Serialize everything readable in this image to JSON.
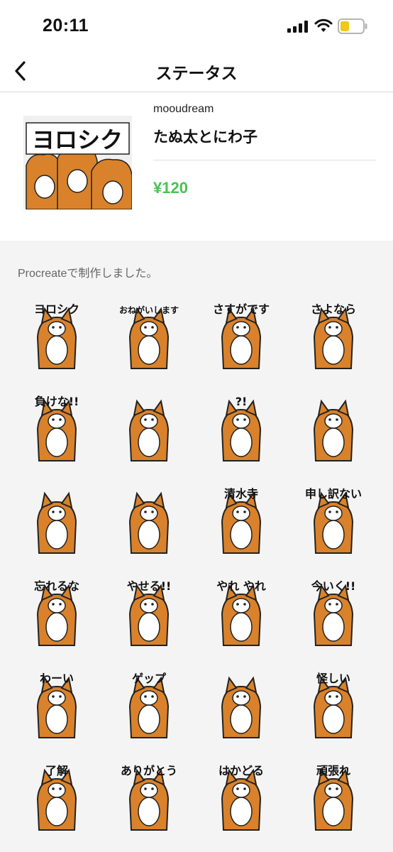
{
  "status_bar": {
    "time": "20:11"
  },
  "nav": {
    "title": "ステータス"
  },
  "product": {
    "creator": "mooudream",
    "title": "たぬ太とにわ子",
    "price": "¥120",
    "thumb_text": "ヨロシク"
  },
  "description": "Procreateで制作しました。",
  "colors": {
    "accent_green": "#49c253",
    "tanuki_orange": "#d9822b",
    "grid_background": "#f4f4f4"
  },
  "stickers": [
    {
      "name": "sticker-yoroshiku",
      "text": "ヨロシク"
    },
    {
      "name": "sticker-onegaishimasu",
      "text": "おねがいします"
    },
    {
      "name": "sticker-sasuga-desu",
      "text": "さすがです"
    },
    {
      "name": "sticker-sayonara",
      "text": "さよなら"
    },
    {
      "name": "sticker-makenai",
      "text": "負けな!!"
    },
    {
      "name": "sticker-confetti",
      "text": ""
    },
    {
      "name": "sticker-question",
      "text": "?!"
    },
    {
      "name": "sticker-sunset",
      "text": ""
    },
    {
      "name": "sticker-curled-up",
      "text": ""
    },
    {
      "name": "sticker-sleeping",
      "text": ""
    },
    {
      "name": "sticker-kiyomizu",
      "text": "清水寺"
    },
    {
      "name": "sticker-moushiwakenai",
      "text": "申し訳ない"
    },
    {
      "name": "sticker-wasureruna",
      "text": "忘れるな"
    },
    {
      "name": "sticker-yaseru",
      "text": "やせる!!"
    },
    {
      "name": "sticker-yare-yare",
      "text": "やれ やれ"
    },
    {
      "name": "sticker-ima-iku",
      "text": "今いく!!"
    },
    {
      "name": "sticker-waai",
      "text": "わーい"
    },
    {
      "name": "sticker-geppu",
      "text": "ゲップ"
    },
    {
      "name": "sticker-ghost",
      "text": ""
    },
    {
      "name": "sticker-ayashii",
      "text": "怪しい"
    },
    {
      "name": "sticker-ryoukai",
      "text": "了解"
    },
    {
      "name": "sticker-pekori-arigatou",
      "text": "ありがとう"
    },
    {
      "name": "sticker-hakadoru",
      "text": "はかどる"
    },
    {
      "name": "sticker-ganbare",
      "text": "頑張れ"
    }
  ]
}
